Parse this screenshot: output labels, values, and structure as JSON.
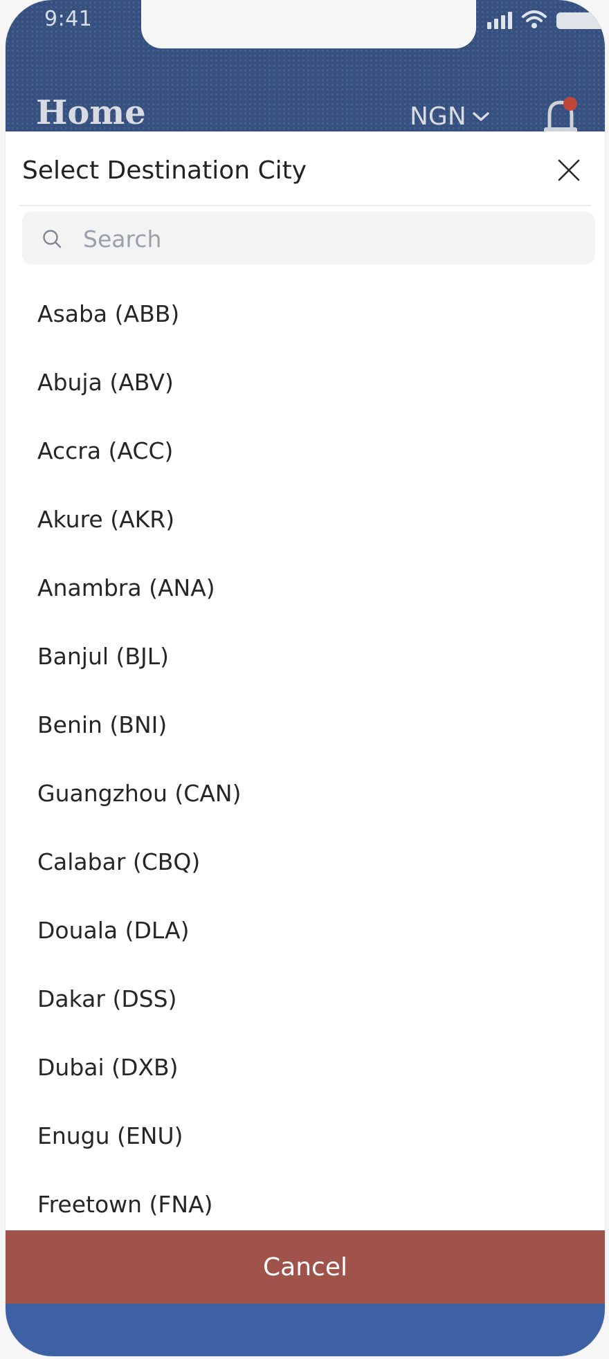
{
  "status_bar": {
    "time": "9:41"
  },
  "app_header": {
    "title": "Home",
    "currency": "NGN",
    "icons": [
      "chevron-down-icon",
      "bell-icon"
    ],
    "colors": {
      "header_bg": "#36507f",
      "notification_dot": "#c0463a"
    }
  },
  "modal": {
    "title": "Select Destination City",
    "search": {
      "placeholder": "Search",
      "value": ""
    },
    "cities": [
      {
        "label": "Asaba (ABB)"
      },
      {
        "label": "Abuja (ABV)"
      },
      {
        "label": "Accra (ACC)"
      },
      {
        "label": "Akure (AKR)"
      },
      {
        "label": "Anambra (ANA)"
      },
      {
        "label": "Banjul (BJL)"
      },
      {
        "label": "Benin (BNI)"
      },
      {
        "label": "Guangzhou (CAN)"
      },
      {
        "label": "Calabar (CBQ)"
      },
      {
        "label": "Douala (DLA)"
      },
      {
        "label": "Dakar (DSS)"
      },
      {
        "label": "Dubai (DXB)"
      },
      {
        "label": "Enugu (ENU)"
      },
      {
        "label": "Freetown (FNA)"
      }
    ],
    "cancel_label": "Cancel",
    "colors": {
      "cancel_bg": "#a0534a",
      "bottom_bar": "#3e61a6"
    }
  }
}
